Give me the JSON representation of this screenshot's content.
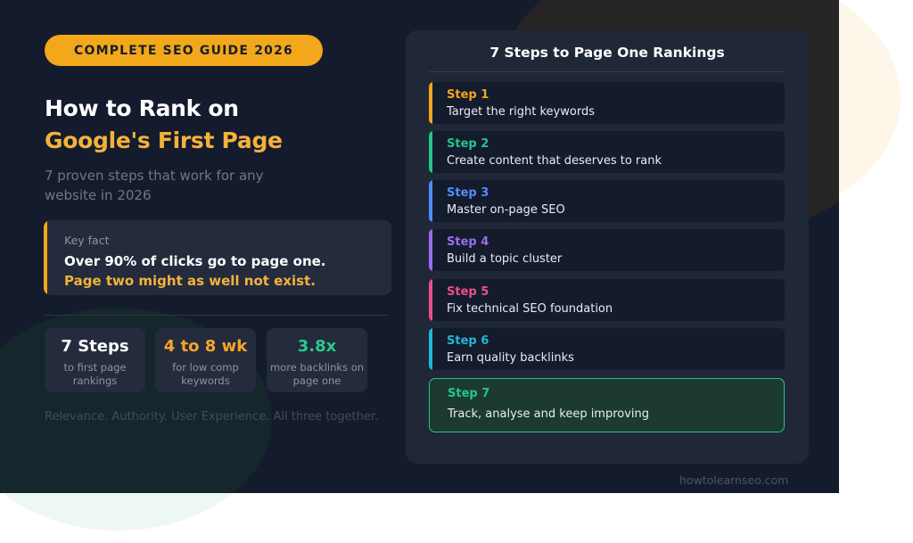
{
  "badge": "COMPLETE SEO GUIDE 2026",
  "title": {
    "line1": "How to Rank on",
    "line2": "Google's First Page"
  },
  "subtitle": "7 proven steps that work for any website in 2026",
  "key_fact": {
    "label": "Key fact",
    "line1": "Over 90% of clicks go to page one.",
    "line2": "Page two might as well not exist."
  },
  "stats": [
    {
      "value": "7 Steps",
      "desc": "to first page rankings",
      "color": "#ffffff"
    },
    {
      "value": "4 to 8 wk",
      "desc": "for low comp keywords",
      "color": "#f4a62a"
    },
    {
      "value": "3.8x",
      "desc": "more backlinks on page one",
      "color": "#2bc98e"
    }
  ],
  "tagline": "Relevance. Authority. User Experience. All three together.",
  "panel": {
    "title": "7 Steps to Page One Rankings",
    "steps": [
      {
        "label": "Step 1",
        "text": "Target the right keywords",
        "color": "#f2a81a"
      },
      {
        "label": "Step 2",
        "text": "Create content that deserves to rank",
        "color": "#25c48b"
      },
      {
        "label": "Step 3",
        "text": "Master on-page SEO",
        "color": "#4f8ef7"
      },
      {
        "label": "Step 4",
        "text": "Build a topic cluster",
        "color": "#9b6cf0"
      },
      {
        "label": "Step 5",
        "text": "Fix technical SEO foundation",
        "color": "#ec4f8b"
      },
      {
        "label": "Step 6",
        "text": "Earn quality backlinks",
        "color": "#22b6d8"
      },
      {
        "label": "Step 7",
        "text": "Track, analyse and keep improving",
        "color": "#25c48b"
      }
    ]
  },
  "website": "howtolearnseo.com"
}
